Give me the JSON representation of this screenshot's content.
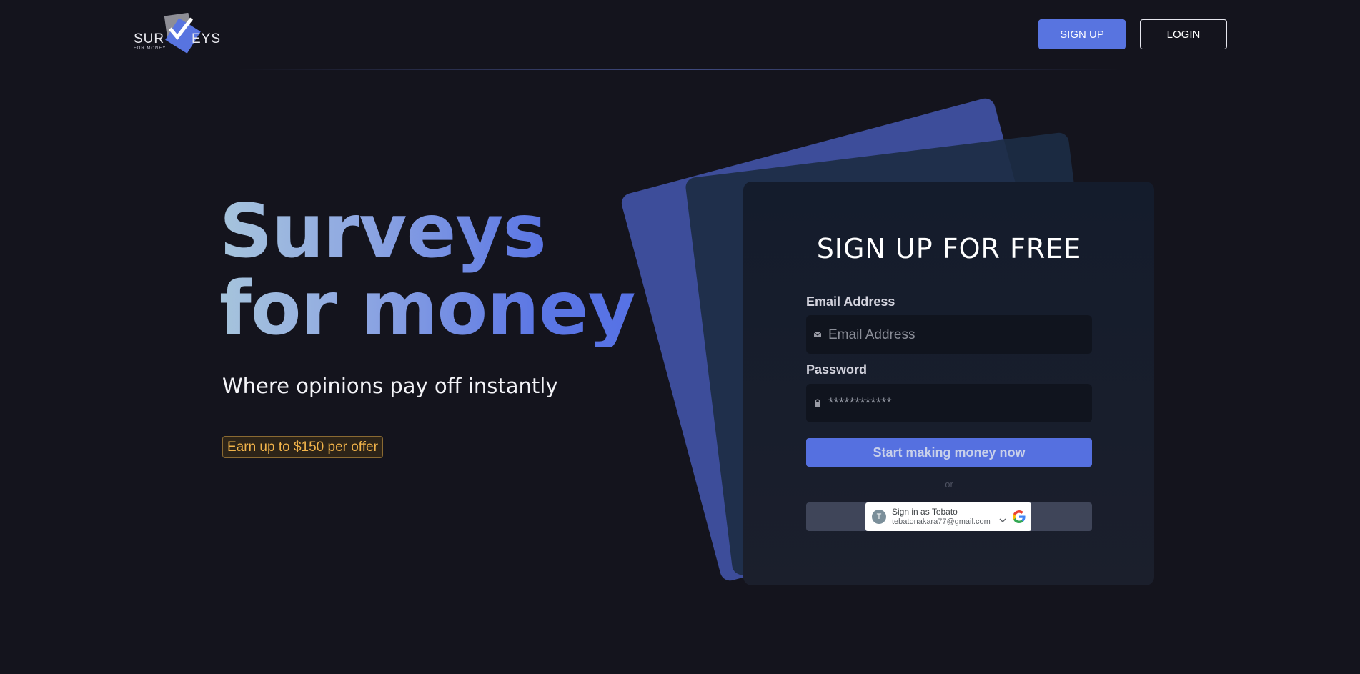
{
  "header": {
    "logo": {
      "text_left": "SUR",
      "text_right": "EYS",
      "subtext": "FOR MONEY"
    },
    "signup_label": "SIGN UP",
    "login_label": "LOGIN"
  },
  "hero": {
    "title_line1": "Surveys",
    "title_line2": "for money",
    "subtitle": "Where opinions pay off instantly",
    "badge": "Earn up to $150 per offer"
  },
  "form": {
    "title": "SIGN UP FOR FREE",
    "email_label": "Email Address",
    "email_placeholder": "Email Address",
    "password_label": "Password",
    "password_value": "************",
    "submit_label": "Start making money now",
    "divider_text": "or",
    "google": {
      "avatar_initial": "T",
      "name": "Sign in as Tebato",
      "email": "tebatonakara77@gmail.com"
    }
  },
  "colors": {
    "background": "#14141d",
    "accent": "#5874e0",
    "badge_text": "#f1b34a"
  }
}
